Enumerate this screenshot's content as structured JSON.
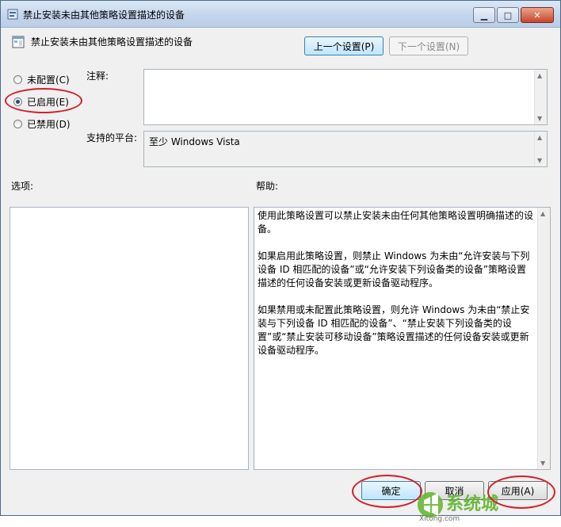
{
  "window": {
    "title": "禁止安装未由其他策略设置描述的设备",
    "caption": {
      "minimize": "▁",
      "maximize": "□",
      "close": "✕"
    }
  },
  "policy": {
    "title": "禁止安装未由其他策略设置描述的设备"
  },
  "nav": {
    "prev_label": "上一个设置(P)",
    "next_label": "下一个设置(N)"
  },
  "state": {
    "options": [
      {
        "label": "未配置(C)",
        "checked": false
      },
      {
        "label": "已启用(E)",
        "checked": true
      },
      {
        "label": "已禁用(D)",
        "checked": false
      }
    ]
  },
  "comment": {
    "label": "注释:",
    "value": ""
  },
  "platform": {
    "label": "支持的平台:",
    "value": "至少 Windows Vista"
  },
  "options_section": {
    "label": "选项:"
  },
  "help_section": {
    "label": "帮助:",
    "paragraphs": [
      "使用此策略设置可以禁止安装未由任何其他策略设置明确描述的设备。",
      "如果启用此策略设置，则禁止 Windows 为未由“允许安装与下列设备 ID 相匹配的设备”或“允许安装下列设备类的设备”策略设置描述的任何设备安装或更新设备驱动程序。",
      "如果禁用或未配置此策略设置，则允许 Windows 为未由“禁止安装与下列设备 ID 相匹配的设备”、“禁止安装下列设备类的设置”或“禁止安装可移动设备”策略设置描述的任何设备安装或更新设备驱动程序。"
    ]
  },
  "footer": {
    "ok_label": "确定",
    "cancel_label": "取消",
    "apply_label": "应用(A)"
  },
  "watermark": {
    "brand": "系统城",
    "domain": "Xitong.com"
  },
  "colors": {
    "highlight": "#d3202a",
    "focus_border": "#3c7fb1",
    "title_bar": "#c3d5ec"
  }
}
